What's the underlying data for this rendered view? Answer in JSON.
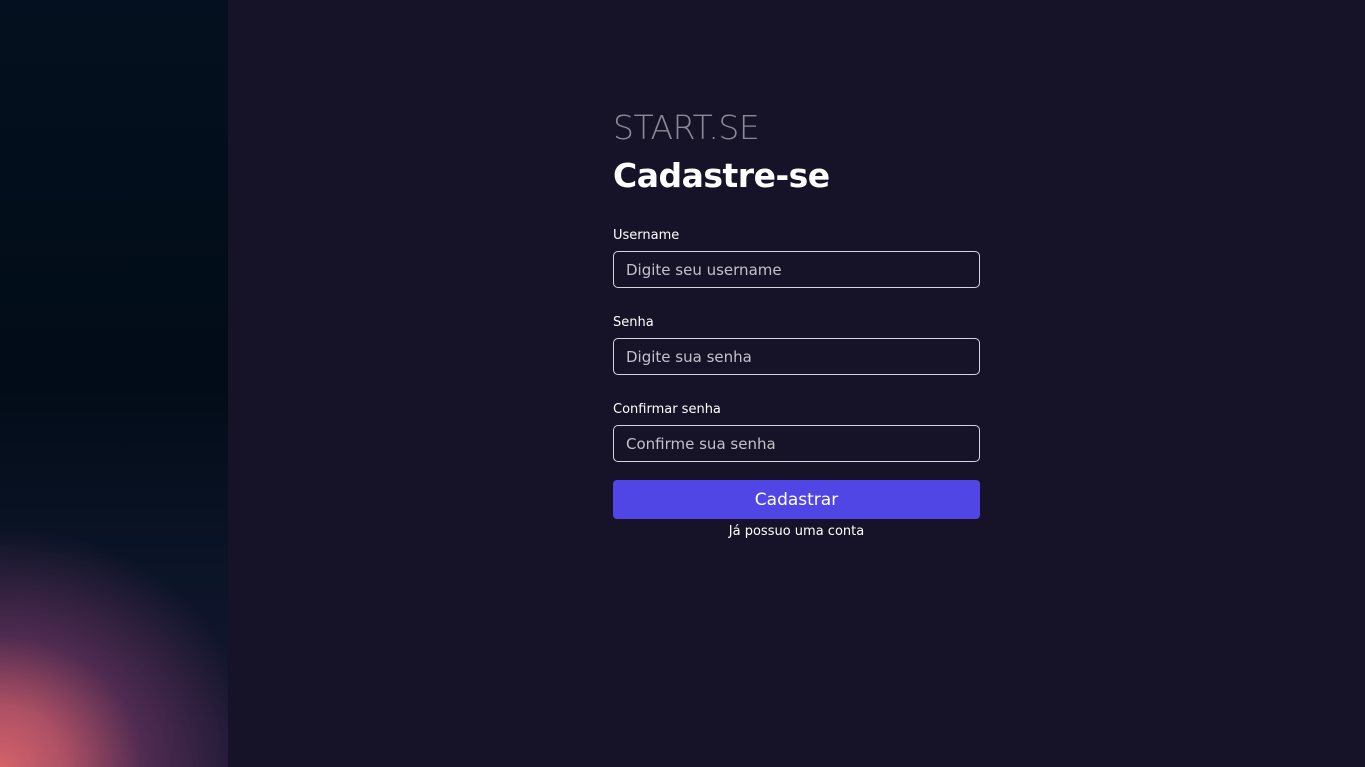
{
  "brand": "START.SE",
  "title": "Cadastre-se",
  "form": {
    "username": {
      "label": "Username",
      "placeholder": "Digite seu username"
    },
    "password": {
      "label": "Senha",
      "placeholder": "Digite sua senha"
    },
    "confirm_password": {
      "label": "Confirmar senha",
      "placeholder": "Confirme sua senha"
    },
    "submit_label": "Cadastrar",
    "login_link": "Já possuo uma conta"
  },
  "colors": {
    "background": "#161328",
    "accent": "#4f46e5",
    "brand_text": "#8c8a98"
  }
}
